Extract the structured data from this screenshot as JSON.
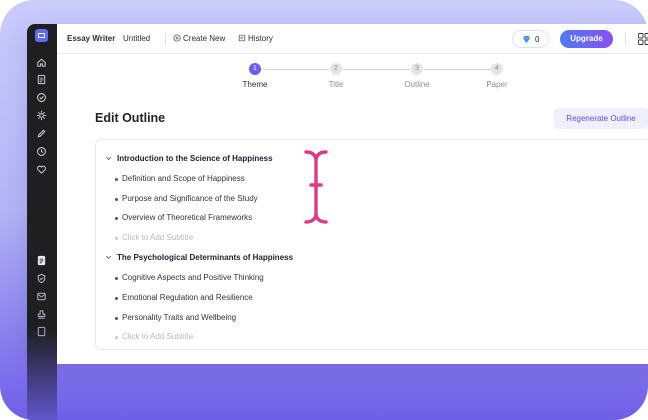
{
  "colors": {
    "accent": "#6b5cf2",
    "upgrade_gradient_start": "#4e7cf6",
    "upgrade_gradient_end": "#8a4ff0",
    "cursor": "#e0398a"
  },
  "topbar": {
    "app_name": "Essay Writer",
    "doc_name": "Untitled",
    "create_new": "Create New",
    "history": "History",
    "credits": "0",
    "upgrade": "Upgrade"
  },
  "steps": [
    {
      "num": "1",
      "label": "Theme",
      "active": true
    },
    {
      "num": "2",
      "label": "Title",
      "active": false
    },
    {
      "num": "3",
      "label": "Outline",
      "active": false
    },
    {
      "num": "4",
      "label": "Paper",
      "active": false
    }
  ],
  "page": {
    "title": "Edit Outline",
    "regenerate": "Regenerate Outline"
  },
  "outline": {
    "sections": [
      {
        "title": "Introduction to the Science of Happiness",
        "subtitles": [
          "Definition and Scope of Happiness",
          "Purpose and Significance of the Study",
          "Overview of Theoretical Frameworks"
        ],
        "add_placeholder": "Click to Add Subtitle"
      },
      {
        "title": "The Psychological Determinants of Happiness",
        "subtitles": [
          "Cognitive Aspects and Positive Thinking",
          "Emotional Regulation and Resilience",
          "Personality Traits and Wellbeing"
        ],
        "add_placeholder": "Click to Add Subtitle"
      }
    ]
  },
  "icons": {
    "rail": [
      "app-logo-icon",
      "home-icon",
      "document-icon",
      "check-circle-icon",
      "gear-icon",
      "pen-icon",
      "history-icon",
      "heart-icon",
      "essay-icon",
      "shield-check-icon",
      "mail-icon",
      "stamp-icon",
      "file-icon"
    ],
    "topbar": [
      "plus-circle-icon",
      "history-icon",
      "diamond-icon",
      "grid-icon"
    ],
    "cursor": "text-cursor-icon"
  }
}
